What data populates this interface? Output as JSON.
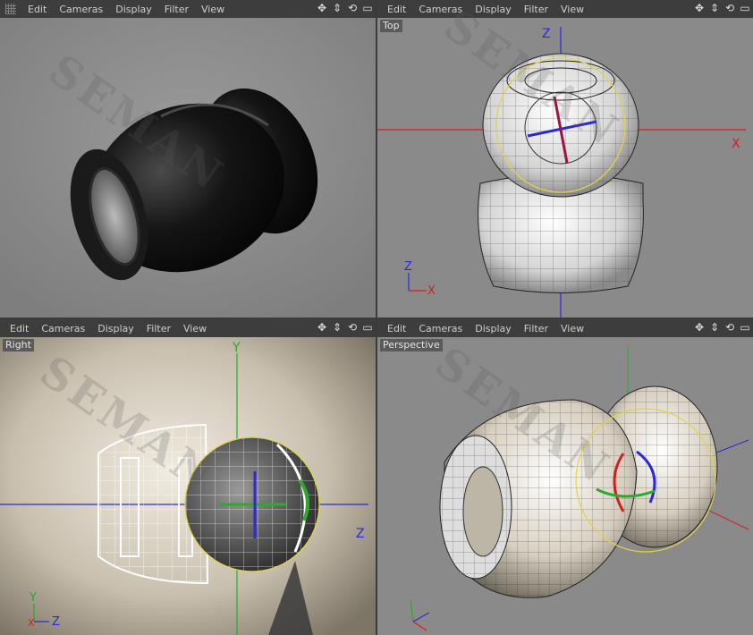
{
  "menu": {
    "edit": "Edit",
    "cameras": "Cameras",
    "display": "Display",
    "filter": "Filter",
    "view": "View"
  },
  "viewports": {
    "top": {
      "label": "Top"
    },
    "right": {
      "label": "Right"
    },
    "perspective": {
      "label": "Perspective"
    }
  },
  "axes": {
    "x": "X",
    "y": "Y",
    "z": "Z"
  },
  "watermark": "SEMAN",
  "icons": [
    "move-icon",
    "zoom-icon",
    "rotate-icon",
    "maximize-icon"
  ],
  "colors": {
    "axis_x": "#d22020",
    "axis_y": "#2ea82e",
    "axis_z": "#2a2ad8",
    "selection": "#e2d24a"
  }
}
